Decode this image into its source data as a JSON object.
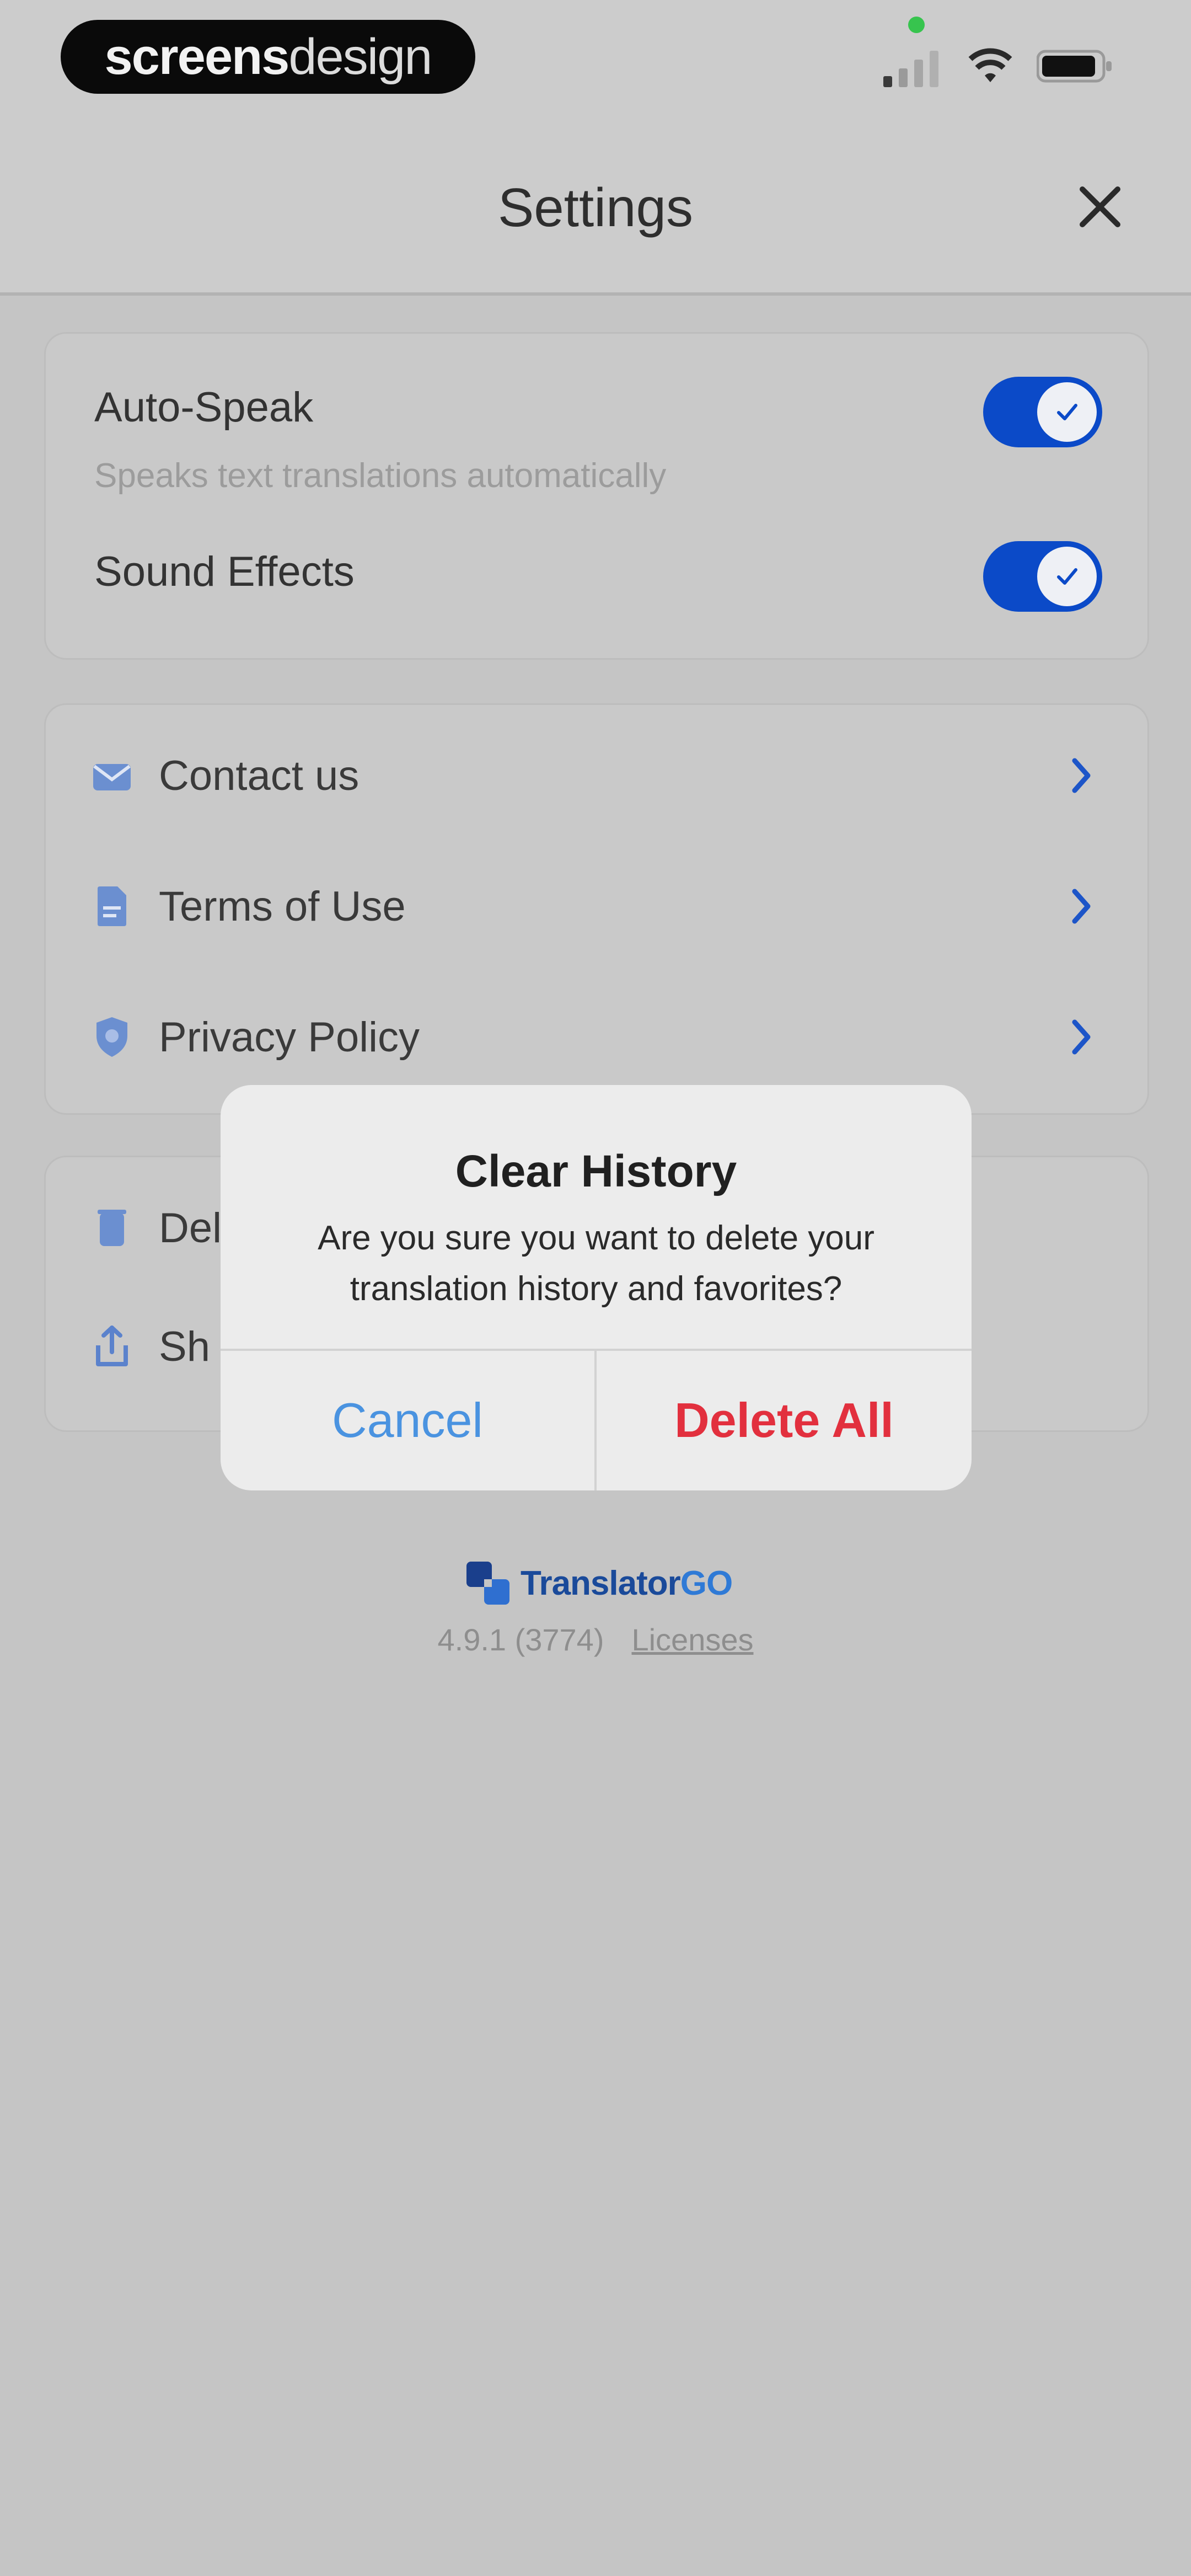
{
  "status_bar": {
    "brand_bold": "screens",
    "brand_light": "design"
  },
  "header": {
    "title": "Settings"
  },
  "settings": {
    "auto_speak": {
      "label": "Auto-Speak",
      "description": "Speaks text translations automatically",
      "enabled": true
    },
    "sound_effects": {
      "label": "Sound Effects",
      "enabled": true
    }
  },
  "links": [
    {
      "label": "Contact us",
      "icon": "mail-icon"
    },
    {
      "label": "Terms of Use",
      "icon": "document-icon"
    },
    {
      "label": "Privacy Policy",
      "icon": "shield-icon"
    }
  ],
  "actions_partial": [
    {
      "label": "Del",
      "icon": "trash-icon"
    },
    {
      "label": "Sh",
      "icon": "share-icon"
    }
  ],
  "dialog": {
    "title": "Clear History",
    "message": "Are you sure you want to delete your translation history and favorites?",
    "cancel_label": "Cancel",
    "delete_label": "Delete All"
  },
  "footer": {
    "app_name_part1": "Translator",
    "app_name_part2": "GO",
    "version": "4.9.1 (3774)",
    "licenses_label": "Licenses"
  },
  "colors": {
    "accent": "#0b4ac8",
    "destructive": "#e2303e",
    "cancel": "#4a93e0"
  }
}
